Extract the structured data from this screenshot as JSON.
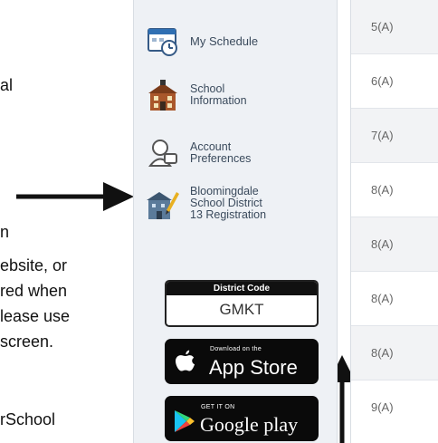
{
  "document_fragments": [
    {
      "id": "frag-al",
      "text": "al"
    },
    {
      "id": "frag-n",
      "text": "n"
    },
    {
      "id": "frag-website",
      "text": "ebsite, or"
    },
    {
      "id": "frag-red",
      "text": "red when"
    },
    {
      "id": "frag-lease",
      "text": "lease use"
    },
    {
      "id": "frag-screen",
      "text": "screen."
    },
    {
      "id": "frag-rschool",
      "text": "rSchool"
    }
  ],
  "sidebar": {
    "items": [
      {
        "label": "My Schedule",
        "icon": "calendar-icon"
      },
      {
        "label": "School\nInformation",
        "icon": "school-building-icon"
      },
      {
        "label": "Account\nPreferences",
        "icon": "account-preferences-icon"
      },
      {
        "label": "Bloomingdale\nSchool District\n13 Registration",
        "icon": "registration-icon"
      }
    ],
    "district_code": {
      "header": "District Code",
      "value": "GMKT"
    },
    "app_store": {
      "small": "Download on the",
      "big": "App Store"
    },
    "google_play": {
      "small": "GET IT ON",
      "big": "Google play"
    }
  },
  "table": {
    "cells": [
      "5(A)",
      "6(A)",
      "7(A)",
      "8(A)",
      "8(A)",
      "8(A)",
      "8(A)",
      "9(A)"
    ]
  },
  "colors": {
    "sidebar_bg": "#eef1f5",
    "label_text": "#3a4a5c",
    "button_bg": "#0a0a0a"
  }
}
